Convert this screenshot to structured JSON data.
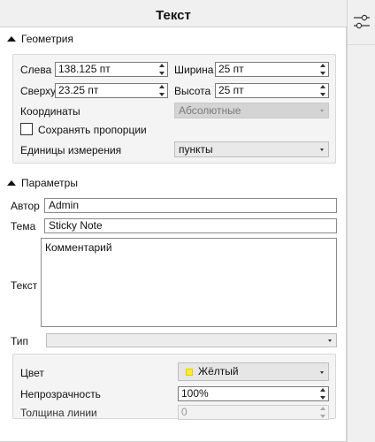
{
  "panel": {
    "title": "Текст"
  },
  "geometry": {
    "header": "Геометрия",
    "left_label": "Слева",
    "left_value": "138.125 пт",
    "top_label": "Сверху",
    "top_value": "23.25 пт",
    "width_label": "Ширина",
    "width_value": "25 пт",
    "height_label": "Высота",
    "height_value": "25 пт",
    "coords_label": "Координаты",
    "coords_value": "Абсолютные",
    "keep_ratio_label": "Сохранять пропорции",
    "units_label": "Единицы измерения",
    "units_value": "пункты"
  },
  "params": {
    "header": "Параметры",
    "author_label": "Автор",
    "author_value": "Admin",
    "subject_label": "Тема",
    "subject_value": "Sticky Note",
    "text_label": "Текст",
    "text_value": "Комментарий",
    "type_label": "Тип",
    "type_value": "",
    "color_label": "Цвет",
    "color_value": "Жёлтый",
    "color_hex": "#ffec2a",
    "opacity_label": "Непрозрачность",
    "opacity_value": "100%",
    "line_width_label": "Толщина линии",
    "line_width_value": "0"
  },
  "sidebar": {
    "icon": "properties-sliders-icon"
  }
}
